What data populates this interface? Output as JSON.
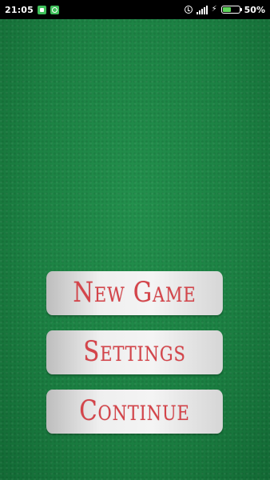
{
  "status_bar": {
    "time": "21:05",
    "battery_percent": "50%",
    "battery_level": 0.5,
    "icons": [
      "notification-icon",
      "notification-icon",
      "alarm-icon",
      "signal-icon",
      "charging-icon",
      "battery-icon"
    ]
  },
  "colors": {
    "felt_green": "#1c8143",
    "button_text_red": "#d4444a",
    "button_bg": "#efefef",
    "battery_green": "#5ed35a"
  },
  "menu": {
    "items": [
      {
        "label": "New Game"
      },
      {
        "label": "Settings"
      },
      {
        "label": "Continue"
      }
    ]
  }
}
